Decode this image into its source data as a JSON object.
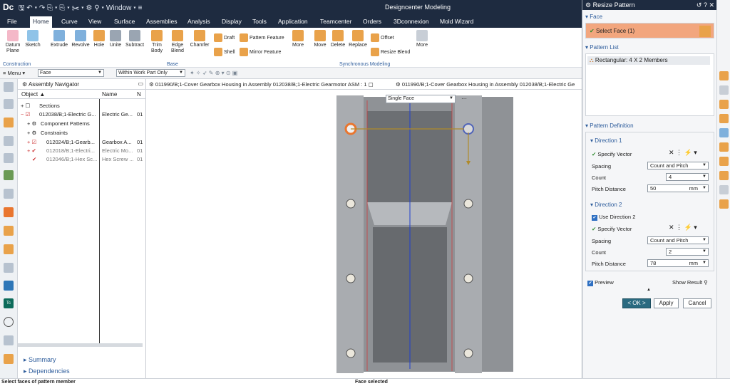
{
  "app": {
    "logo": "Dc",
    "window_label": "Window",
    "title": "Designcenter Modeling"
  },
  "menu": {
    "tabs": [
      "File",
      "Home",
      "Curve",
      "View",
      "Surface",
      "Assemblies",
      "Analysis",
      "Display",
      "Tools",
      "Application",
      "Teamcenter",
      "Orders",
      "3Dconnexion",
      "Mold Wizard"
    ],
    "active": "Home"
  },
  "ribbon": {
    "datum_plane": "Datum Plane",
    "sketch": "Sketch",
    "construction": "Construction",
    "base": [
      "Extrude",
      "Revolve",
      "Hole",
      "Unite",
      "Subtract"
    ],
    "trim_body": "Trim Body",
    "edge_blend": "Edge Blend",
    "chamfer": "Chamfer",
    "draft": "Draft",
    "shell": "Shell",
    "pattern_feature": "Pattern Feature",
    "mirror_feature": "Mirror Feature",
    "more": "More",
    "base_label": "Base",
    "sync": [
      "Move",
      "Delete",
      "Replace"
    ],
    "offset": "Offset",
    "resize_blend": "Resize Blend",
    "sync_label": "Synchronous Modeling"
  },
  "selbar": {
    "menu": "Menu",
    "filter": "Face",
    "scope": "Within Work Part Only"
  },
  "navigator": {
    "title": "Assembly Navigator",
    "columns": [
      "Object",
      "Name",
      "N"
    ],
    "rows": [
      {
        "indent": 0,
        "label": "Sections",
        "name": "",
        "n": ""
      },
      {
        "indent": 0,
        "label": "012038/B;1-Electric G...",
        "name": "Electric Ge...",
        "n": "01"
      },
      {
        "indent": 1,
        "label": "Component Patterns",
        "name": "",
        "n": ""
      },
      {
        "indent": 1,
        "label": "Constraints",
        "name": "",
        "n": ""
      },
      {
        "indent": 1,
        "label": "012024/B;1-Gearb...",
        "name": "Gearbox A...",
        "n": "01"
      },
      {
        "indent": 1,
        "label": "012018/B;1-Electri...",
        "name": "Electric Mo...",
        "n": "01"
      },
      {
        "indent": 1,
        "label": "012046/B;1-Hex Sc...",
        "name": "Hex Screw ...",
        "n": "01"
      }
    ],
    "summary": "Summary",
    "dependencies": "Dependencies"
  },
  "tabs": {
    "tab1": "011990/B;1-Cover Gearbox Housing in Assembly 012038/B;1-Electric Gearmotor ASM : 1",
    "tab2": "011990/B;1-Cover Gearbox Housing in Assembly 012038/B;1-Electric Ge"
  },
  "viewport": {
    "face_filter": "Single Face",
    "more": "···"
  },
  "status": {
    "left": "Select faces of pattern member",
    "center": "Face selected"
  },
  "dialog": {
    "title": "Resize Pattern",
    "face_section": "Face",
    "select_face": "Select Face (1)",
    "pattern_list_section": "Pattern List",
    "pattern_item": "Rectangular: 4 X 2 Members",
    "pattern_def_section": "Pattern Definition",
    "dir1": "Direction 1",
    "specify_vector": "Specify Vector",
    "spacing": "Spacing",
    "spacing_value": "Count and Pitch",
    "count": "Count",
    "count1": "4",
    "pitch": "Pitch Distance",
    "pitch1": "50",
    "unit": "mm",
    "dir2": "Direction 2",
    "use_dir2": "Use Direction 2",
    "count2": "2",
    "pitch2": "78",
    "preview": "Preview",
    "show_result": "Show Result",
    "ok": "< OK >",
    "apply": "Apply",
    "cancel": "Cancel"
  }
}
